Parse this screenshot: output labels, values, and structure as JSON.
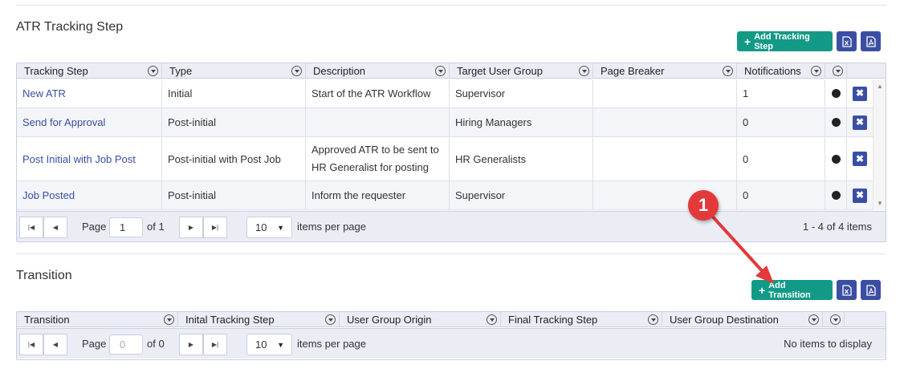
{
  "tracking": {
    "title": "ATR Tracking Step",
    "add_label": "Add Tracking Step",
    "columns": [
      "Tracking Step",
      "Type",
      "Description",
      "Target User Group",
      "Page Breaker",
      "Notifications"
    ],
    "rows": [
      {
        "step": "New ATR",
        "type": "Initial",
        "desc1": "Start of the ATR Workflow",
        "desc2": "",
        "group": "Supervisor",
        "breaker": "",
        "notifications": "1"
      },
      {
        "step": "Send for Approval",
        "type": "Post-initial",
        "desc1": "",
        "desc2": "",
        "group": "Hiring Managers",
        "breaker": "",
        "notifications": "0"
      },
      {
        "step": "Post Initial with Job Post",
        "type": "Post-initial with Post Job",
        "desc1": "Approved ATR to be sent to",
        "desc2": "HR Generalist for posting",
        "group": "HR Generalists",
        "breaker": "",
        "notifications": "0"
      },
      {
        "step": "Job Posted",
        "type": "Post-initial",
        "desc1": "Inform the requester",
        "desc2": "",
        "group": "Supervisor",
        "breaker": "",
        "notifications": "0"
      }
    ],
    "pager": {
      "page_label": "Page",
      "page_value": "1",
      "of_label": "of 1",
      "page_size": "10",
      "per_page_label": "items per page",
      "info": "1 - 4 of 4 items"
    }
  },
  "transition": {
    "title": "Transition",
    "add_label": "Add Transition",
    "columns": [
      "Transition",
      "Inital Tracking Step",
      "User Group Origin",
      "Final Tracking Step",
      "User Group Destination"
    ],
    "pager": {
      "page_label": "Page",
      "page_value": "0",
      "of_label": "of 0",
      "page_size": "10",
      "per_page_label": "items per page",
      "info": "No items to display"
    }
  },
  "annotation": {
    "step_number": "1"
  },
  "colors": {
    "accent_green": "#139a86",
    "accent_blue": "#3a4ea3",
    "annotation_red": "#e23a3a"
  }
}
